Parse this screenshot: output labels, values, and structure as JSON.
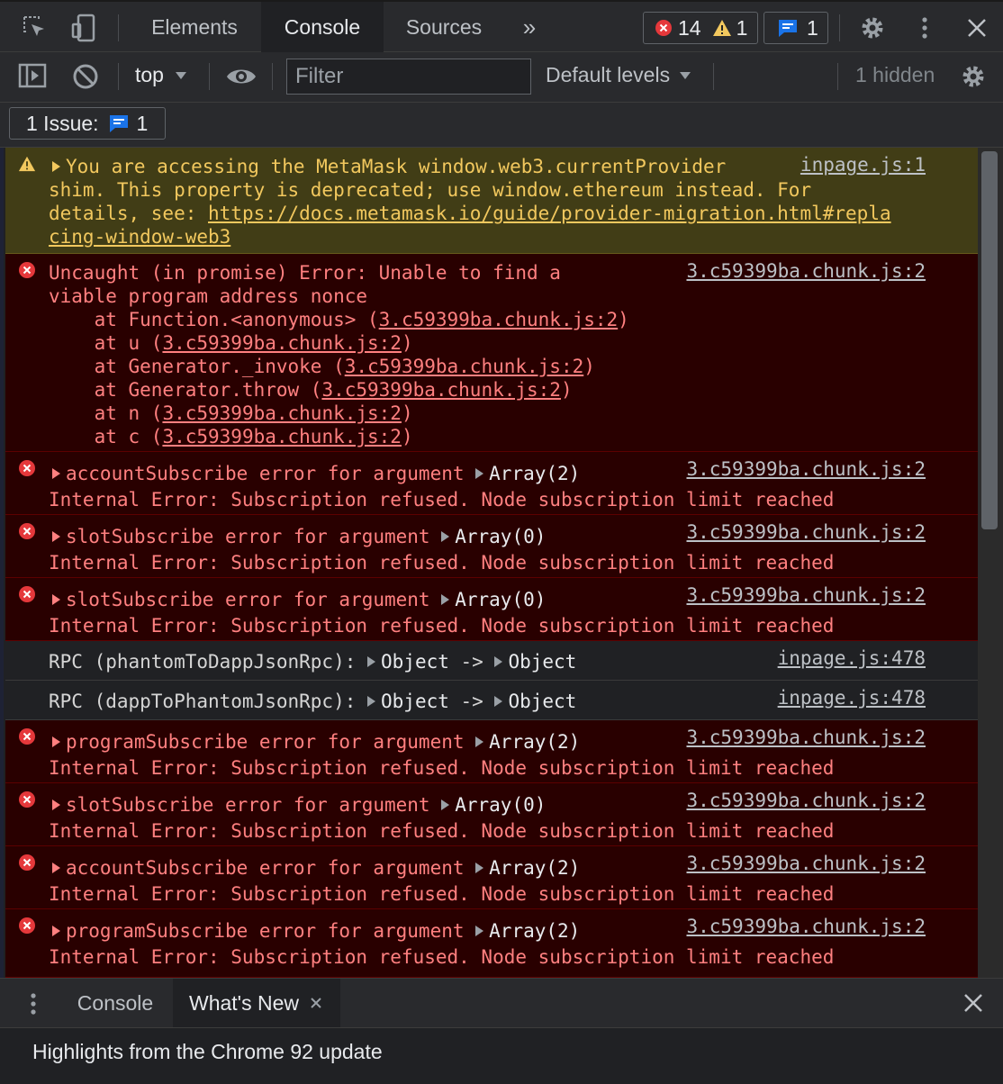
{
  "tabs": {
    "items": [
      "Elements",
      "Console",
      "Sources"
    ],
    "more": "»",
    "active": "Console"
  },
  "counters": {
    "errors": "14",
    "warnings": "1",
    "messages": "1"
  },
  "toolbar": {
    "context": "top",
    "filter_placeholder": "Filter",
    "levels": "Default levels",
    "hidden": "1 hidden"
  },
  "issues": {
    "label": "1 Issue:",
    "count": "1"
  },
  "messages": [
    {
      "type": "warning",
      "lines": [
        "You are accessing the MetaMask window.web3.currentProvider",
        "shim. This property is deprecated; use window.ethereum instead. For",
        "details, see: "
      ],
      "link": "https://docs.metamask.io/guide/provider-migration.html#repla",
      "link2": "cing-window-web3",
      "source": "inpage.js:1"
    },
    {
      "type": "error",
      "lines": [
        "Uncaught (in promise) Error: Unable to find a",
        "viable program address nonce"
      ],
      "stack": [
        {
          "prefix": "    at Function.<anonymous> (",
          "src": "3.c59399ba.chunk.js:2"
        },
        {
          "prefix": "    at u (",
          "src": "3.c59399ba.chunk.js:2"
        },
        {
          "prefix": "    at Generator._invoke (",
          "src": "3.c59399ba.chunk.js:2"
        },
        {
          "prefix": "    at Generator.throw (",
          "src": "3.c59399ba.chunk.js:2"
        },
        {
          "prefix": "    at n (",
          "src": "3.c59399ba.chunk.js:2"
        },
        {
          "prefix": "    at c (",
          "src": "3.c59399ba.chunk.js:2"
        }
      ],
      "source": "3.c59399ba.chunk.js:2"
    },
    {
      "type": "error",
      "head": "accountSubscribe error for argument ",
      "arg": "Array(2)",
      "detail": "Internal Error: Subscription refused. Node subscription limit reached",
      "source": "3.c59399ba.chunk.js:2"
    },
    {
      "type": "error",
      "head": "slotSubscribe error for argument ",
      "arg": "Array(0)",
      "detail": "Internal Error: Subscription refused. Node subscription limit reached",
      "source": "3.c59399ba.chunk.js:2"
    },
    {
      "type": "error",
      "head": "slotSubscribe error for argument ",
      "arg": "Array(0)",
      "detail": "Internal Error: Subscription refused. Node subscription limit reached",
      "source": "3.c59399ba.chunk.js:2"
    },
    {
      "type": "info",
      "head": "RPC (phantomToDappJsonRpc): ",
      "obj1": "Object",
      "arrow": " -> ",
      "obj2": "Object",
      "source": "inpage.js:478"
    },
    {
      "type": "info",
      "head": "RPC (dappToPhantomJsonRpc): ",
      "obj1": "Object",
      "arrow": " -> ",
      "obj2": "Object",
      "source": "inpage.js:478"
    },
    {
      "type": "error",
      "head": "programSubscribe error for argument ",
      "arg": "Array(2)",
      "detail": "Internal Error: Subscription refused. Node subscription limit reached",
      "source": "3.c59399ba.chunk.js:2"
    },
    {
      "type": "error",
      "head": "slotSubscribe error for argument ",
      "arg": "Array(0)",
      "detail": "Internal Error: Subscription refused. Node subscription limit reached",
      "source": "3.c59399ba.chunk.js:2"
    },
    {
      "type": "error",
      "head": "accountSubscribe error for argument ",
      "arg": "Array(2)",
      "detail": "Internal Error: Subscription refused. Node subscription limit reached",
      "source": "3.c59399ba.chunk.js:2"
    },
    {
      "type": "error",
      "head": "programSubscribe error for argument ",
      "arg": "Array(2)",
      "detail": "Internal Error: Subscription refused. Node subscription limit reached",
      "source": "3.c59399ba.chunk.js:2"
    }
  ],
  "drawer": {
    "tabs": [
      "Console",
      "What's New"
    ],
    "active": "What's New",
    "content": "Highlights from the Chrome 92 update"
  },
  "colors": {
    "error_bg": "#290000",
    "error_text": "#ff8080",
    "warning_bg": "#413d16",
    "warning_text": "#f2c85e",
    "accent_blue": "#1a73e8"
  },
  "icons": [
    "inspect-icon",
    "device-toggle-icon",
    "more-tabs-icon",
    "error-icon",
    "warning-icon",
    "message-icon",
    "settings-icon",
    "kebab-icon",
    "close-icon",
    "sidebar-icon",
    "clear-icon",
    "dropdown-icon",
    "eye-icon"
  ]
}
